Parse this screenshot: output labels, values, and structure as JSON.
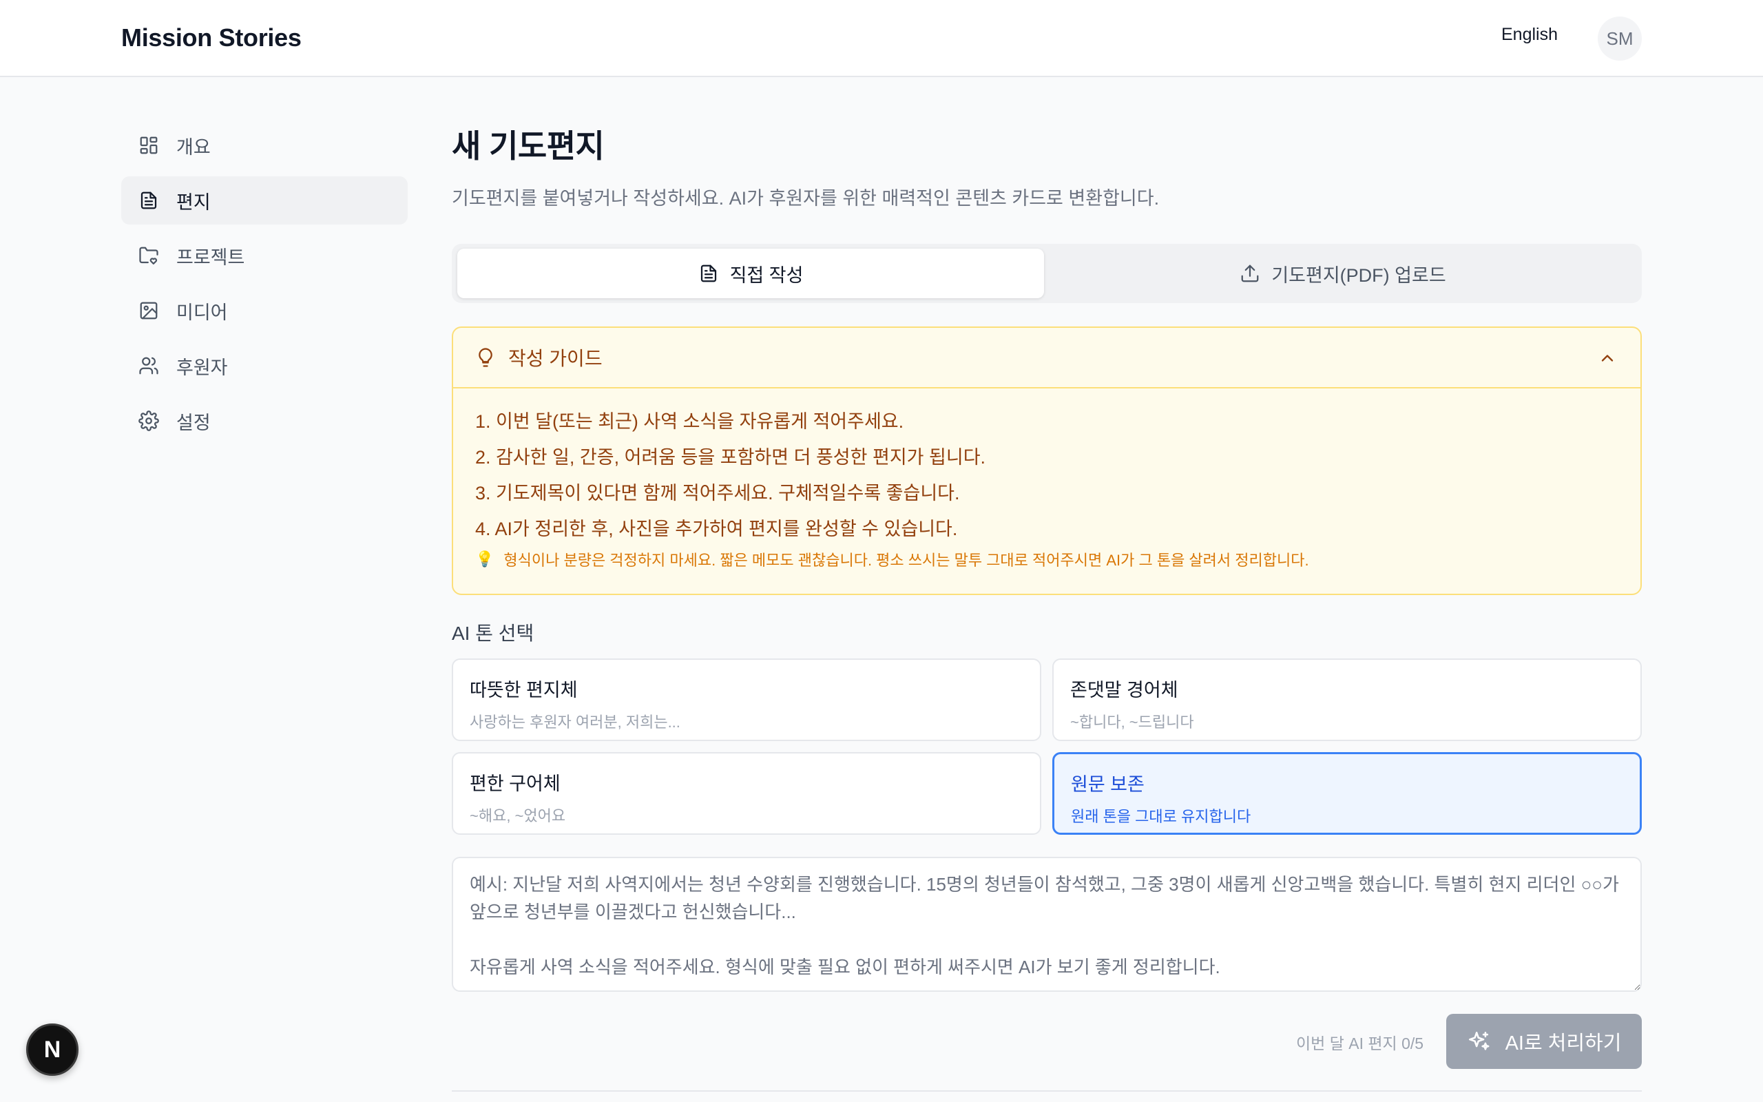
{
  "header": {
    "brand": "Mission Stories",
    "language": "English",
    "avatar_initials": "SM"
  },
  "sidebar": {
    "items": [
      {
        "label": "개요",
        "icon": "dashboard-icon",
        "active": false
      },
      {
        "label": "편지",
        "icon": "document-icon",
        "active": true
      },
      {
        "label": "프로젝트",
        "icon": "folder-heart-icon",
        "active": false
      },
      {
        "label": "미디어",
        "icon": "image-icon",
        "active": false
      },
      {
        "label": "후원자",
        "icon": "users-icon",
        "active": false
      },
      {
        "label": "설정",
        "icon": "gear-icon",
        "active": false
      }
    ]
  },
  "main": {
    "title": "새 기도편지",
    "subtitle": "기도편지를 붙여넣거나 작성하세요. AI가 후원자를 위한 매력적인 콘텐츠 카드로 변환합니다.",
    "tabs": [
      {
        "label": "직접 작성",
        "icon": "document-icon",
        "active": true
      },
      {
        "label": "기도편지(PDF) 업로드",
        "icon": "upload-icon",
        "active": false
      }
    ],
    "guide": {
      "title": "작성 가이드",
      "lines": [
        "1. 이번 달(또는 최근) 사역 소식을 자유롭게 적어주세요.",
        "2. 감사한 일, 간증, 어려움 등을 포함하면 더 풍성한 편지가 됩니다.",
        "3. 기도제목이 있다면 함께 적어주세요. 구체적일수록 좋습니다.",
        "4. AI가 정리한 후, 사진을 추가하여 편지를 완성할 수 있습니다."
      ],
      "tip": "형식이나 분량은 걱정하지 마세요. 짧은 메모도 괜찮습니다. 평소 쓰시는 말투 그대로 적어주시면 AI가 그 톤을 살려서 정리합니다."
    },
    "tone": {
      "label": "AI 톤 선택",
      "options": [
        {
          "title": "따뜻한 편지체",
          "desc": "사랑하는 후원자 여러분, 저희는...",
          "selected": false
        },
        {
          "title": "존댓말 경어체",
          "desc": "~합니다, ~드립니다",
          "selected": false
        },
        {
          "title": "편한 구어체",
          "desc": "~해요, ~었어요",
          "selected": false
        },
        {
          "title": "원문 보존",
          "desc": "원래 톤을 그대로 유지합니다",
          "selected": true
        }
      ]
    },
    "input": {
      "placeholder": "예시: 지난달 저희 사역지에서는 청년 수양회를 진행했습니다. 15명의 청년들이 참석했고, 그중 3명이 새롭게 신앙고백을 했습니다. 특별히 현지 리더인 ○○가 앞으로 청년부를 이끌겠다고 헌신했습니다...\n\n자유롭게 사역 소식을 적어주세요. 형식에 맞출 필요 없이 편하게 써주시면 AI가 보기 좋게 정리합니다.",
      "value": ""
    },
    "usage": "이번 달 AI 편지 0/5",
    "submit_label": "AI로 처리하기"
  },
  "dev_badge": "N",
  "colors": {
    "accent_blue": "#3b82f6",
    "guide_bg": "#fefbeb",
    "guide_text": "#92400e",
    "disabled_button": "#9ca3af"
  }
}
